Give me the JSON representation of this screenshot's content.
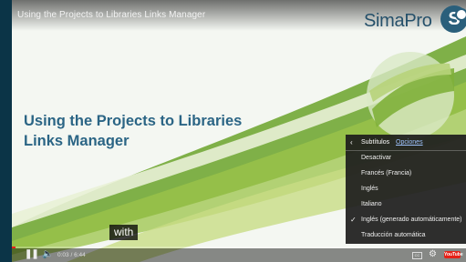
{
  "video": {
    "title": "Using the Projects to Libraries Links Manager",
    "logo_text": "SimaPro",
    "logo_letter": "S",
    "slide_title_line1": "Using the Projects to Libraries",
    "slide_title_line2": "Links Manager",
    "caption": "with"
  },
  "subtitles_menu": {
    "back_icon": "chevron-left-icon",
    "title": "Subtítulos",
    "options_link": "Opciones",
    "items": [
      {
        "label": "Desactivar",
        "selected": false
      },
      {
        "label": "Francés (Francia)",
        "selected": false
      },
      {
        "label": "Inglés",
        "selected": false
      },
      {
        "label": "Italiano",
        "selected": false
      },
      {
        "label": "Inglés (generado automáticamente)",
        "selected": true
      },
      {
        "label": "Traducción automática",
        "selected": false
      }
    ],
    "check_icon": "check-icon"
  },
  "player": {
    "time": "0:03 / 6:44",
    "progress": 0.0074,
    "play_pause_icon": "pause-icon",
    "volume_icon": "volume-icon",
    "cc_icon": "subtitles-icon",
    "settings_icon": "gear-icon",
    "youtube_label": "YouTube",
    "fullscreen_icon": "fullscreen-icon"
  },
  "colors": {
    "accent_blue": "#2b6585",
    "progress_red": "#e62117",
    "slide_green": "#6aa32a"
  }
}
